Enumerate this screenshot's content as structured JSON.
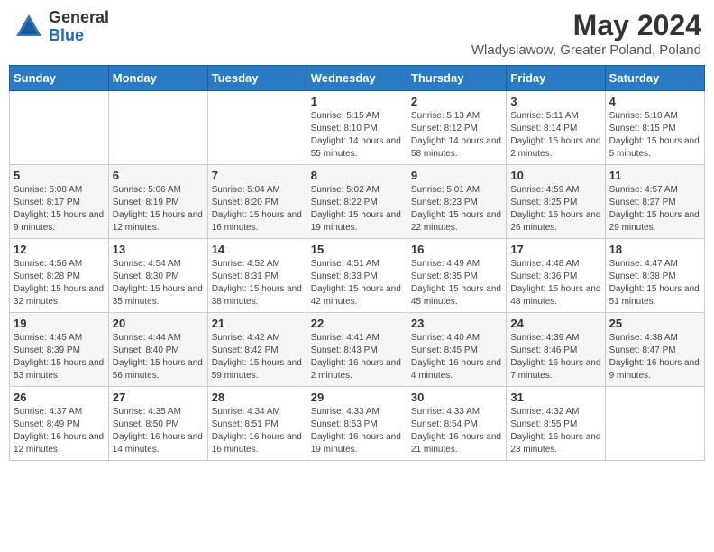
{
  "logo": {
    "general": "General",
    "blue": "Blue"
  },
  "title": {
    "month_year": "May 2024",
    "location": "Wladyslawow, Greater Poland, Poland"
  },
  "weekdays": [
    "Sunday",
    "Monday",
    "Tuesday",
    "Wednesday",
    "Thursday",
    "Friday",
    "Saturday"
  ],
  "weeks": [
    [
      {
        "day": "",
        "info": ""
      },
      {
        "day": "",
        "info": ""
      },
      {
        "day": "",
        "info": ""
      },
      {
        "day": "1",
        "info": "Sunrise: 5:15 AM\nSunset: 8:10 PM\nDaylight: 14 hours and 55 minutes."
      },
      {
        "day": "2",
        "info": "Sunrise: 5:13 AM\nSunset: 8:12 PM\nDaylight: 14 hours and 58 minutes."
      },
      {
        "day": "3",
        "info": "Sunrise: 5:11 AM\nSunset: 8:14 PM\nDaylight: 15 hours and 2 minutes."
      },
      {
        "day": "4",
        "info": "Sunrise: 5:10 AM\nSunset: 8:15 PM\nDaylight: 15 hours and 5 minutes."
      }
    ],
    [
      {
        "day": "5",
        "info": "Sunrise: 5:08 AM\nSunset: 8:17 PM\nDaylight: 15 hours and 9 minutes."
      },
      {
        "day": "6",
        "info": "Sunrise: 5:06 AM\nSunset: 8:19 PM\nDaylight: 15 hours and 12 minutes."
      },
      {
        "day": "7",
        "info": "Sunrise: 5:04 AM\nSunset: 8:20 PM\nDaylight: 15 hours and 16 minutes."
      },
      {
        "day": "8",
        "info": "Sunrise: 5:02 AM\nSunset: 8:22 PM\nDaylight: 15 hours and 19 minutes."
      },
      {
        "day": "9",
        "info": "Sunrise: 5:01 AM\nSunset: 8:23 PM\nDaylight: 15 hours and 22 minutes."
      },
      {
        "day": "10",
        "info": "Sunrise: 4:59 AM\nSunset: 8:25 PM\nDaylight: 15 hours and 26 minutes."
      },
      {
        "day": "11",
        "info": "Sunrise: 4:57 AM\nSunset: 8:27 PM\nDaylight: 15 hours and 29 minutes."
      }
    ],
    [
      {
        "day": "12",
        "info": "Sunrise: 4:56 AM\nSunset: 8:28 PM\nDaylight: 15 hours and 32 minutes."
      },
      {
        "day": "13",
        "info": "Sunrise: 4:54 AM\nSunset: 8:30 PM\nDaylight: 15 hours and 35 minutes."
      },
      {
        "day": "14",
        "info": "Sunrise: 4:52 AM\nSunset: 8:31 PM\nDaylight: 15 hours and 38 minutes."
      },
      {
        "day": "15",
        "info": "Sunrise: 4:51 AM\nSunset: 8:33 PM\nDaylight: 15 hours and 42 minutes."
      },
      {
        "day": "16",
        "info": "Sunrise: 4:49 AM\nSunset: 8:35 PM\nDaylight: 15 hours and 45 minutes."
      },
      {
        "day": "17",
        "info": "Sunrise: 4:48 AM\nSunset: 8:36 PM\nDaylight: 15 hours and 48 minutes."
      },
      {
        "day": "18",
        "info": "Sunrise: 4:47 AM\nSunset: 8:38 PM\nDaylight: 15 hours and 51 minutes."
      }
    ],
    [
      {
        "day": "19",
        "info": "Sunrise: 4:45 AM\nSunset: 8:39 PM\nDaylight: 15 hours and 53 minutes."
      },
      {
        "day": "20",
        "info": "Sunrise: 4:44 AM\nSunset: 8:40 PM\nDaylight: 15 hours and 56 minutes."
      },
      {
        "day": "21",
        "info": "Sunrise: 4:42 AM\nSunset: 8:42 PM\nDaylight: 15 hours and 59 minutes."
      },
      {
        "day": "22",
        "info": "Sunrise: 4:41 AM\nSunset: 8:43 PM\nDaylight: 16 hours and 2 minutes."
      },
      {
        "day": "23",
        "info": "Sunrise: 4:40 AM\nSunset: 8:45 PM\nDaylight: 16 hours and 4 minutes."
      },
      {
        "day": "24",
        "info": "Sunrise: 4:39 AM\nSunset: 8:46 PM\nDaylight: 16 hours and 7 minutes."
      },
      {
        "day": "25",
        "info": "Sunrise: 4:38 AM\nSunset: 8:47 PM\nDaylight: 16 hours and 9 minutes."
      }
    ],
    [
      {
        "day": "26",
        "info": "Sunrise: 4:37 AM\nSunset: 8:49 PM\nDaylight: 16 hours and 12 minutes."
      },
      {
        "day": "27",
        "info": "Sunrise: 4:35 AM\nSunset: 8:50 PM\nDaylight: 16 hours and 14 minutes."
      },
      {
        "day": "28",
        "info": "Sunrise: 4:34 AM\nSunset: 8:51 PM\nDaylight: 16 hours and 16 minutes."
      },
      {
        "day": "29",
        "info": "Sunrise: 4:33 AM\nSunset: 8:53 PM\nDaylight: 16 hours and 19 minutes."
      },
      {
        "day": "30",
        "info": "Sunrise: 4:33 AM\nSunset: 8:54 PM\nDaylight: 16 hours and 21 minutes."
      },
      {
        "day": "31",
        "info": "Sunrise: 4:32 AM\nSunset: 8:55 PM\nDaylight: 16 hours and 23 minutes."
      },
      {
        "day": "",
        "info": ""
      }
    ]
  ]
}
